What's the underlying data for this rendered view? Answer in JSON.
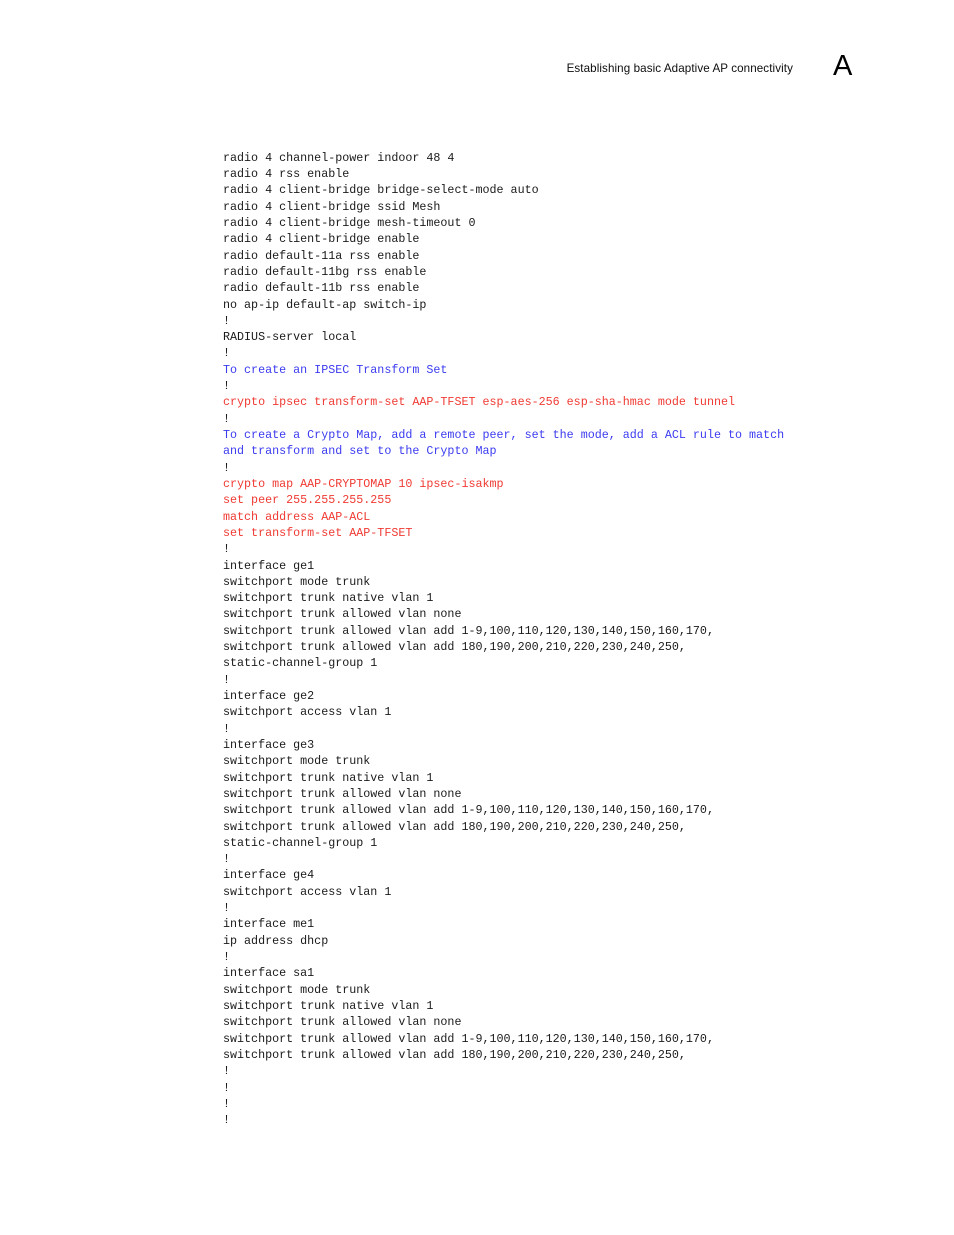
{
  "header": {
    "title": "Establishing basic Adaptive AP connectivity",
    "appendix_letter": "A"
  },
  "colors": {
    "text": "#1a1a1a",
    "comment_blue": "#3b3bf0",
    "command_red": "#f03a33",
    "page_background": "#ffffff"
  },
  "code_listing": {
    "lines": [
      {
        "text": "radio 4 channel-power indoor 48 4",
        "color": "black"
      },
      {
        "text": "radio 4 rss enable",
        "color": "black"
      },
      {
        "text": "radio 4 client-bridge bridge-select-mode auto",
        "color": "black"
      },
      {
        "text": "radio 4 client-bridge ssid Mesh",
        "color": "black"
      },
      {
        "text": "radio 4 client-bridge mesh-timeout 0",
        "color": "black"
      },
      {
        "text": "radio 4 client-bridge enable",
        "color": "black"
      },
      {
        "text": "radio default-11a rss enable",
        "color": "black"
      },
      {
        "text": "radio default-11bg rss enable",
        "color": "black"
      },
      {
        "text": "radio default-11b rss enable",
        "color": "black"
      },
      {
        "text": "no ap-ip default-ap switch-ip",
        "color": "black"
      },
      {
        "text": "!",
        "color": "black"
      },
      {
        "text": "RADIUS-server local",
        "color": "black"
      },
      {
        "text": "!",
        "color": "black"
      },
      {
        "text": "To create an IPSEC Transform Set",
        "color": "blue"
      },
      {
        "text": "!",
        "color": "black"
      },
      {
        "text": "crypto ipsec transform-set AAP-TFSET esp-aes-256 esp-sha-hmac mode tunnel",
        "color": "red"
      },
      {
        "text": "!",
        "color": "black"
      },
      {
        "text": "To create a Crypto Map, add a remote peer, set the mode, add a ACL rule to match",
        "color": "blue"
      },
      {
        "text": "and transform and set to the Crypto Map",
        "color": "blue"
      },
      {
        "text": "!",
        "color": "black"
      },
      {
        "text": "crypto map AAP-CRYPTOMAP 10 ipsec-isakmp",
        "color": "red"
      },
      {
        "text": "set peer 255.255.255.255",
        "color": "red"
      },
      {
        "text": "match address AAP-ACL",
        "color": "red"
      },
      {
        "text": "set transform-set AAP-TFSET",
        "color": "red"
      },
      {
        "text": "!",
        "color": "black"
      },
      {
        "text": "interface ge1",
        "color": "black"
      },
      {
        "text": "switchport mode trunk",
        "color": "black"
      },
      {
        "text": "switchport trunk native vlan 1",
        "color": "black"
      },
      {
        "text": "switchport trunk allowed vlan none",
        "color": "black"
      },
      {
        "text": "switchport trunk allowed vlan add 1-9,100,110,120,130,140,150,160,170,",
        "color": "black"
      },
      {
        "text": "switchport trunk allowed vlan add 180,190,200,210,220,230,240,250,",
        "color": "black"
      },
      {
        "text": "static-channel-group 1",
        "color": "black"
      },
      {
        "text": "!",
        "color": "black"
      },
      {
        "text": "interface ge2",
        "color": "black"
      },
      {
        "text": "switchport access vlan 1",
        "color": "black"
      },
      {
        "text": "!",
        "color": "black"
      },
      {
        "text": "interface ge3",
        "color": "black"
      },
      {
        "text": "switchport mode trunk",
        "color": "black"
      },
      {
        "text": "switchport trunk native vlan 1",
        "color": "black"
      },
      {
        "text": "switchport trunk allowed vlan none",
        "color": "black"
      },
      {
        "text": "switchport trunk allowed vlan add 1-9,100,110,120,130,140,150,160,170,",
        "color": "black"
      },
      {
        "text": "switchport trunk allowed vlan add 180,190,200,210,220,230,240,250,",
        "color": "black"
      },
      {
        "text": "static-channel-group 1",
        "color": "black"
      },
      {
        "text": "!",
        "color": "black"
      },
      {
        "text": "interface ge4",
        "color": "black"
      },
      {
        "text": "switchport access vlan 1",
        "color": "black"
      },
      {
        "text": "!",
        "color": "black"
      },
      {
        "text": "interface me1",
        "color": "black"
      },
      {
        "text": "ip address dhcp",
        "color": "black"
      },
      {
        "text": "!",
        "color": "black"
      },
      {
        "text": "interface sa1",
        "color": "black"
      },
      {
        "text": "switchport mode trunk",
        "color": "black"
      },
      {
        "text": "switchport trunk native vlan 1",
        "color": "black"
      },
      {
        "text": "switchport trunk allowed vlan none",
        "color": "black"
      },
      {
        "text": "switchport trunk allowed vlan add 1-9,100,110,120,130,140,150,160,170,",
        "color": "black"
      },
      {
        "text": "switchport trunk allowed vlan add 180,190,200,210,220,230,240,250,",
        "color": "black"
      },
      {
        "text": "!",
        "color": "black"
      },
      {
        "text": "!",
        "color": "black"
      },
      {
        "text": "!",
        "color": "black"
      },
      {
        "text": "!",
        "color": "black"
      }
    ]
  }
}
